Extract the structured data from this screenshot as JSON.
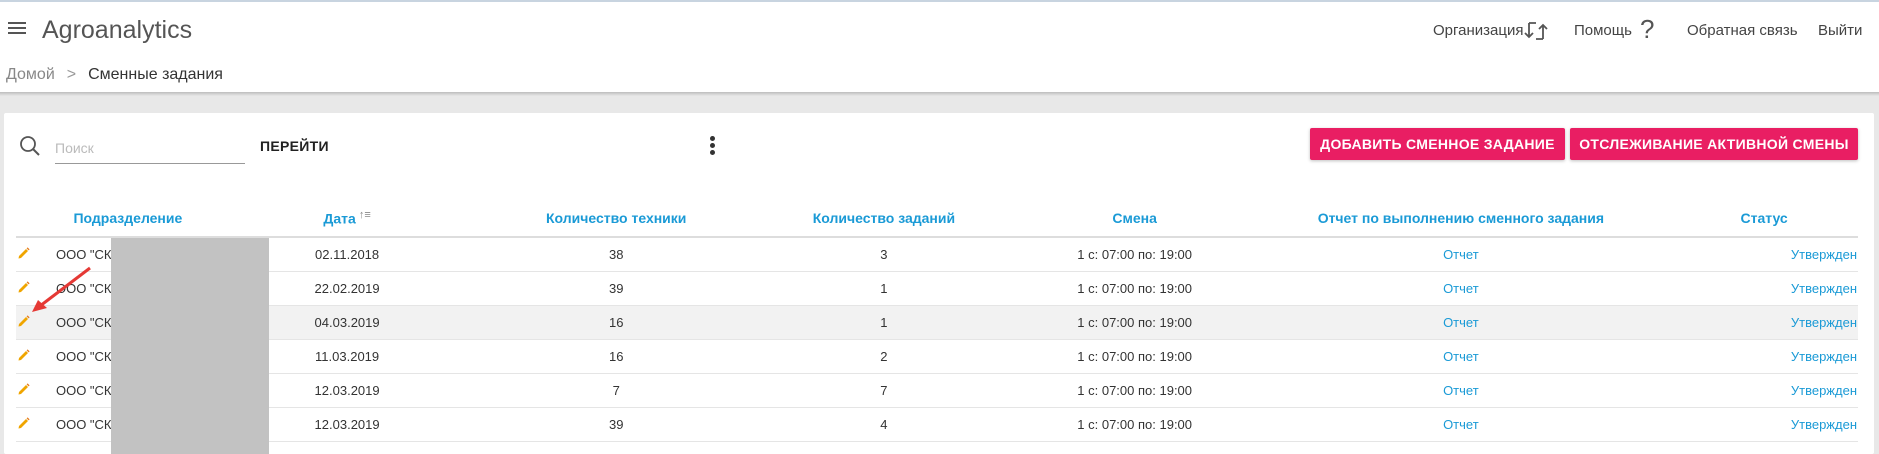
{
  "app": {
    "title": "Agroanalytics"
  },
  "header": {
    "organization": "Организация",
    "help": "Помощь",
    "feedback": "Обратная связь",
    "logout": "Выйти"
  },
  "breadcrumb": {
    "home": "Домой",
    "separator": ">",
    "current": "Сменные задания"
  },
  "toolbar": {
    "search_placeholder": "Поиск",
    "search_value": "",
    "go_label": "ПЕРЕЙТИ",
    "add_button": "ДОБАВИТЬ СМЕННОЕ ЗАДАНИЕ",
    "track_button": "ОТСЛЕЖИВАНИЕ АКТИВНОЙ СМЕНЫ"
  },
  "colors": {
    "accent": "#e91e63",
    "link": "#1a9ad6",
    "pencil": "#f0a500",
    "annotation": "#e53935"
  },
  "table": {
    "columns": [
      "Подразделение",
      "Дата",
      "Количество техники",
      "Количество заданий",
      "Смена",
      "Отчет по выполнению сменного задания",
      "Статус"
    ],
    "rows": [
      {
        "dept": "ООО \"СК",
        "date": "02.11.2018",
        "tech": "38",
        "tasks": "3",
        "shift": "1 с: 07:00 по: 19:00",
        "report": "Отчет",
        "status": "Утвержден"
      },
      {
        "dept": "ООО \"СК",
        "date": "22.02.2019",
        "tech": "39",
        "tasks": "1",
        "shift": "1 с: 07:00 по: 19:00",
        "report": "Отчет",
        "status": "Утвержден"
      },
      {
        "dept": "ООО \"СК",
        "date": "04.03.2019",
        "tech": "16",
        "tasks": "1",
        "shift": "1 с: 07:00 по: 19:00",
        "report": "Отчет",
        "status": "Утвержден"
      },
      {
        "dept": "ООО \"СК",
        "date": "11.03.2019",
        "tech": "16",
        "tasks": "2",
        "shift": "1 с: 07:00 по: 19:00",
        "report": "Отчет",
        "status": "Утвержден"
      },
      {
        "dept": "ООО \"СК",
        "date": "12.03.2019",
        "tech": "7",
        "tasks": "7",
        "shift": "1 с: 07:00 по: 19:00",
        "report": "Отчет",
        "status": "Утвержден"
      },
      {
        "dept": "ООО \"СК",
        "date": "12.03.2019",
        "tech": "39",
        "tasks": "4",
        "shift": "1 с: 07:00 по: 19:00",
        "report": "Отчет",
        "status": "Утвержден"
      }
    ]
  }
}
